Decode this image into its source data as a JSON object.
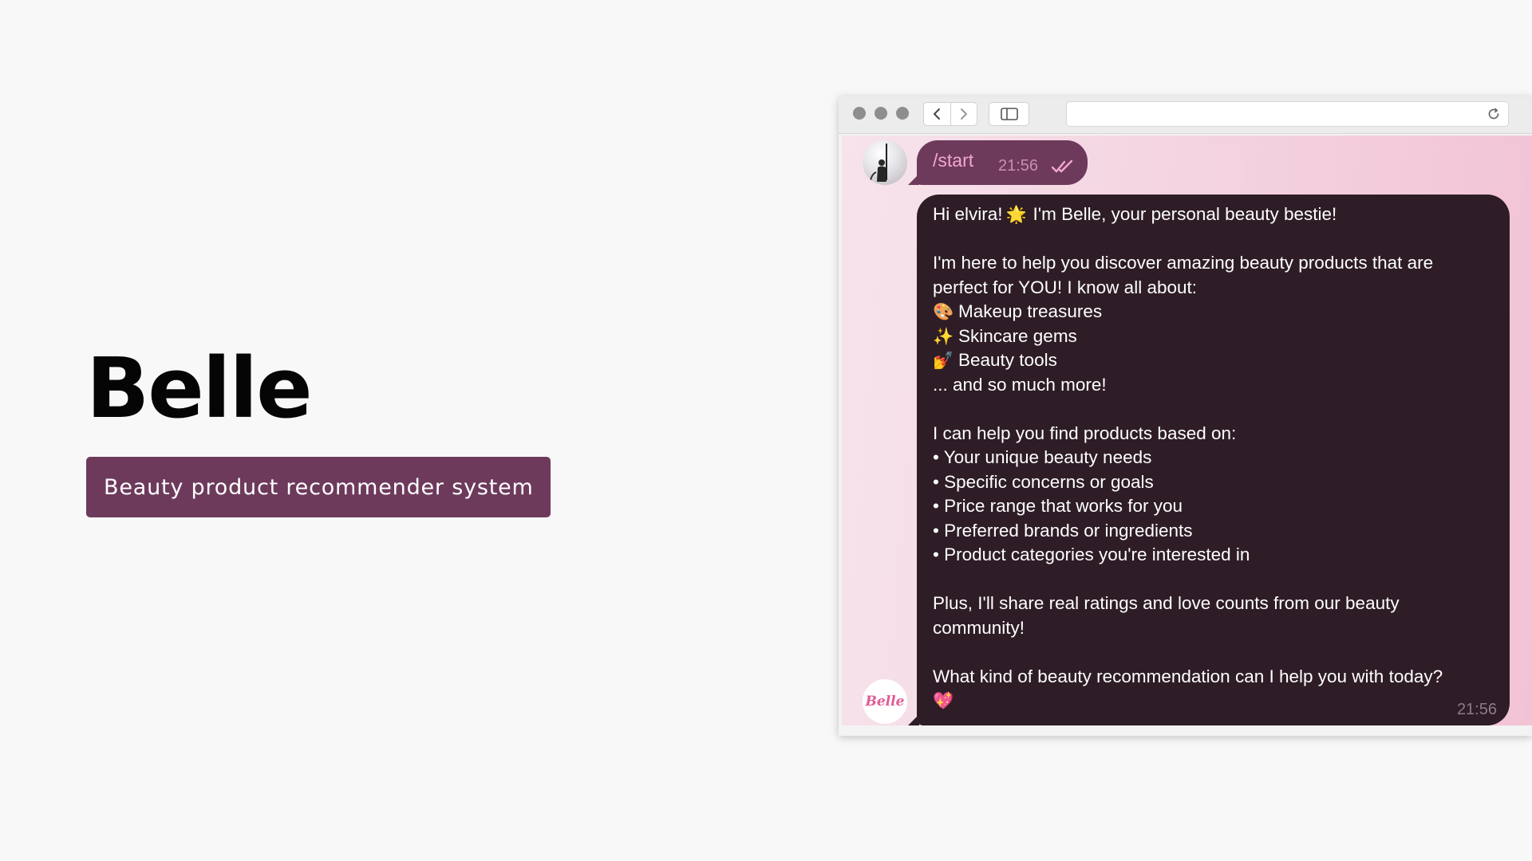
{
  "hero": {
    "title": "Belle",
    "badge": "Beauty product recommender system"
  },
  "browser": {
    "toolbar": {
      "icons": [
        "traffic-light-close",
        "traffic-light-minimize",
        "traffic-light-maximize",
        "back-arrow-icon",
        "forward-arrow-icon",
        "sidebar-toggle-icon",
        "reload-icon"
      ],
      "address": ""
    },
    "chat": {
      "bot_avatar_text": "Belle",
      "user_message": {
        "text": "/start",
        "time": "21:56",
        "status": "read"
      },
      "bot_message": {
        "greeting": "Hi elvira!",
        "greeting_emoji": "🌟",
        "greeting_rest": "I'm Belle, your personal beauty bestie!",
        "intro_line1": "I'm here to help you discover amazing beauty products that are",
        "intro_line2": "perfect for YOU! I know all about:",
        "categories": [
          {
            "emoji": "🎨",
            "label": "Makeup treasures"
          },
          {
            "emoji": "✨",
            "label": "Skincare gems"
          },
          {
            "emoji": "💅",
            "label": "Beauty tools"
          }
        ],
        "more": "... and so much more!",
        "basis_heading": "I can help you find products based on:",
        "basis_items": [
          "• Your unique beauty needs",
          "• Specific concerns or goals",
          "• Price range that works for you",
          "• Preferred brands or ingredients",
          "• Product categories you're interested in"
        ],
        "ratings_line1": "Plus, I'll share real ratings and love counts from our beauty",
        "ratings_line2": "community!",
        "question": "What kind of beauty recommendation can I help you with today?",
        "question_emoji": "💖",
        "time": "21:56"
      }
    }
  },
  "colors": {
    "badge_bg": "#6d3a5c",
    "user_bubble": "#6d3a5c",
    "bot_bubble": "#2e1d26",
    "chat_bg": "#f4d6e2",
    "accent_pink": "#f2a7cb"
  }
}
